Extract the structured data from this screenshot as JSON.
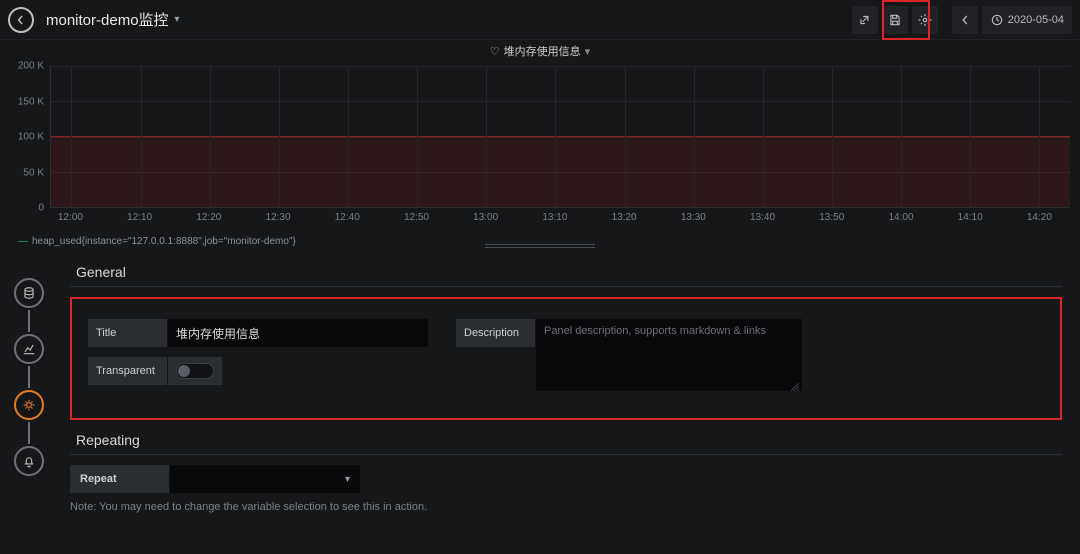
{
  "header": {
    "title": "monitor-demo监控",
    "time_label": "2020-05-04"
  },
  "panel": {
    "title": "堆内存使用信息",
    "legend_label": "heap_used{instance=\"127.0.0.1:8888\",job=\"monitor-demo\"}"
  },
  "chart_data": {
    "type": "area",
    "title": "堆内存使用信息",
    "xlabel": "",
    "ylabel": "",
    "ylim": [
      0,
      200000
    ],
    "y_ticks": [
      "200 K",
      "150 K",
      "100 K",
      "50 K",
      "0"
    ],
    "x_ticks": [
      "12:00",
      "12:10",
      "12:20",
      "12:30",
      "12:40",
      "12:50",
      "13:00",
      "13:10",
      "13:20",
      "13:30",
      "13:40",
      "13:50",
      "14:00",
      "14:10",
      "14:20"
    ],
    "series": [
      {
        "name": "heap_used{instance=\"127.0.0.1:8888\",job=\"monitor-demo\"}",
        "color": "#8b2121",
        "x": [
          "12:00",
          "12:10",
          "12:20",
          "12:30",
          "12:40",
          "12:50",
          "13:00",
          "13:10",
          "13:20",
          "13:30",
          "13:40",
          "13:50",
          "14:00",
          "14:10",
          "14:20"
        ],
        "values": [
          100000,
          100000,
          100000,
          100000,
          100000,
          100000,
          100000,
          100000,
          100000,
          100000,
          100000,
          100000,
          100000,
          100000,
          100000
        ]
      }
    ]
  },
  "editor": {
    "section_general": "General",
    "section_repeating": "Repeating",
    "title_label": "Title",
    "title_value": "堆内存使用信息",
    "transparent_label": "Transparent",
    "description_label": "Description",
    "description_placeholder": "Panel description, supports markdown & links",
    "repeat_label": "Repeat",
    "repeat_note": "Note: You may need to change the variable selection to see this in action."
  }
}
